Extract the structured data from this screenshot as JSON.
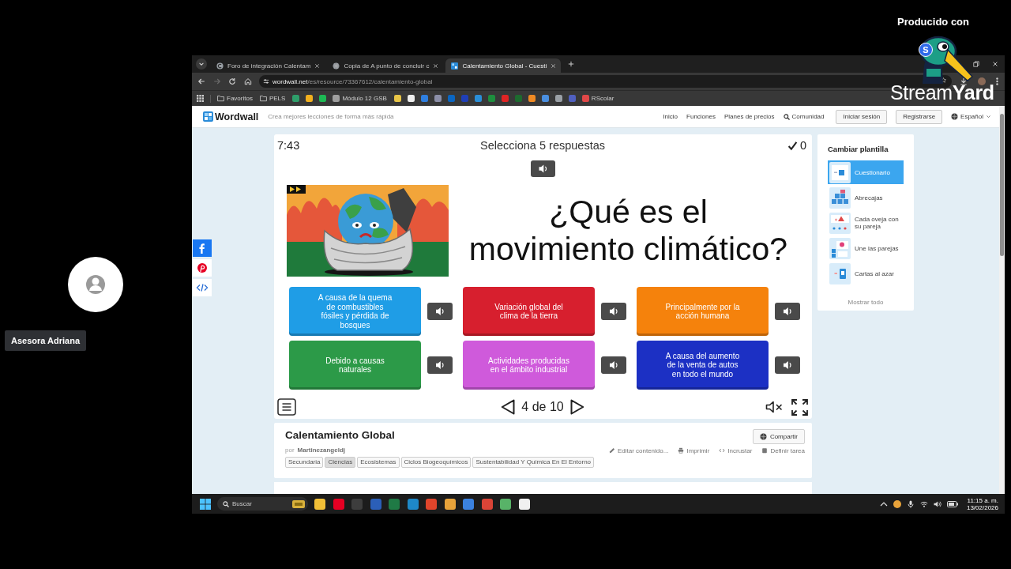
{
  "stream": {
    "produced_label": "Producido con",
    "logo_badge": "S",
    "brand": "Stream**Yard**"
  },
  "participant": {
    "name": "Asesora Adriana"
  },
  "browser": {
    "tabs": [
      {
        "title": "Foro de integración Calentam",
        "selected": false
      },
      {
        "title": "Copia de A punto de concluir c",
        "selected": false
      },
      {
        "title": "Calentamiento Global - Cuesti",
        "selected": true
      }
    ],
    "url": {
      "host": "wordwall.net",
      "path": "/es/resource/73367612/calentamiento-global"
    },
    "bookmarks": [
      {
        "kind": "folder",
        "label": "Favoritos"
      },
      {
        "kind": "folder",
        "label": "PELS"
      },
      {
        "kind": "icon",
        "color": "#2e9e6a"
      },
      {
        "kind": "icon",
        "color": "#f2b01e"
      },
      {
        "kind": "icon",
        "color": "#1db954"
      },
      {
        "kind": "link",
        "label": "Módulo 12 GSB",
        "color": "#9e9e9e"
      },
      {
        "kind": "icon",
        "color": "#e8c547"
      },
      {
        "kind": "icon",
        "color": "#eeeeee"
      },
      {
        "kind": "icon",
        "color": "#2f7fe0"
      },
      {
        "kind": "icon",
        "color": "#8c8fa8"
      },
      {
        "kind": "icon",
        "color": "#0a66c2"
      },
      {
        "kind": "icon",
        "color": "#1f3fb8"
      },
      {
        "kind": "icon",
        "color": "#2a8fd8"
      },
      {
        "kind": "icon",
        "color": "#1e8e3e"
      },
      {
        "kind": "icon",
        "color": "#e02424"
      },
      {
        "kind": "icon",
        "color": "#1d6b2f"
      },
      {
        "kind": "icon",
        "color": "#f08a24"
      },
      {
        "kind": "icon",
        "color": "#4a8fe0"
      },
      {
        "kind": "icon",
        "color": "#9aa0a6"
      },
      {
        "kind": "icon",
        "color": "#5060c0"
      },
      {
        "kind": "link",
        "label": "RScolar",
        "color": "#e04848"
      }
    ]
  },
  "site": {
    "logo": "Wordwall",
    "tagline": "Crea mejores lecciones de forma más rápida",
    "nav": [
      {
        "kind": "link",
        "label": "Inicio"
      },
      {
        "kind": "link",
        "label": "Funciones"
      },
      {
        "kind": "link",
        "label": "Planes de precios"
      },
      {
        "kind": "search",
        "label": "Comunidad"
      }
    ],
    "login": "Iniciar sesión",
    "signup": "Registrarse",
    "language": "Español"
  },
  "game": {
    "timer": "7:43",
    "instruction": "Selecciona 5 respuestas",
    "score": "0",
    "question": "¿Qué es el movimiento climático?",
    "answers": [
      {
        "text": "A causa de la quema de combustibles fósiles y pérdida de bosques",
        "color": "#1f9de6"
      },
      {
        "text": "Variación global del clima de la tierra",
        "color": "#d71f2e"
      },
      {
        "text": "Principalmente por la acción humana",
        "color": "#f5820c"
      },
      {
        "text": "Debido a causas naturales",
        "color": "#2c9a48"
      },
      {
        "text": "Actividades producidas en el ámbito industrial",
        "color": "#cf5adb"
      },
      {
        "text": "A causa del aumento de la venta de autos en todo el mundo",
        "color": "#1c30c4"
      }
    ],
    "progress": "4 de 10"
  },
  "activity": {
    "title": "Calentamiento Global",
    "author_label": "por",
    "author": "Martinezangeldj",
    "tags": [
      {
        "label": "Secundaria",
        "highlighted": false
      },
      {
        "label": "Ciencias",
        "highlighted": true
      },
      {
        "label": "Ecosistemas",
        "highlighted": false
      },
      {
        "label": "Ciclos Biogeoquímicos",
        "highlighted": false
      },
      {
        "label": "Sustentabilidad Y Química En El Entorno",
        "highlighted": false
      }
    ],
    "share": "Compartir",
    "actions": [
      "Editar contenido...",
      "Imprimir",
      "Incrustar",
      "Definir tarea"
    ]
  },
  "templates": {
    "title": "Cambiar plantilla",
    "items": [
      {
        "label": "Cuestionario",
        "selected": true
      },
      {
        "label": "Abrecajas",
        "selected": false
      },
      {
        "label": "Cada oveja con su pareja",
        "selected": false
      },
      {
        "label": "Une las parejas",
        "selected": false
      },
      {
        "label": "Cartas al azar",
        "selected": false
      }
    ],
    "show_all": "Mostrar todo"
  },
  "taskbar": {
    "search": {
      "placeholder": "Buscar"
    },
    "apps": [
      {
        "color": "#f2c037"
      },
      {
        "color": "#e60023"
      },
      {
        "color": "#3d3d3d"
      },
      {
        "color": "#2b5fb8"
      },
      {
        "color": "#1f7a45"
      },
      {
        "color": "#1e88c8"
      },
      {
        "color": "#e0452b"
      },
      {
        "color": "#e8a33a"
      },
      {
        "color": "#3b82e0"
      },
      {
        "color": "#db4437"
      },
      {
        "color": "#58b368"
      },
      {
        "color": "#f0f0f0"
      }
    ],
    "time": "11:15 a. m.",
    "date": "13/02/2026"
  }
}
